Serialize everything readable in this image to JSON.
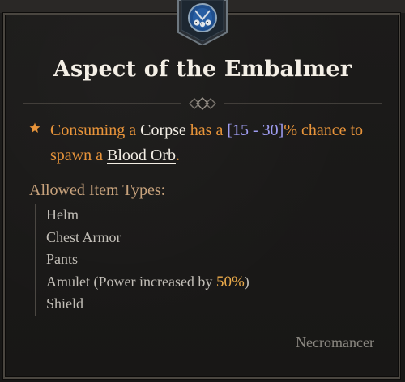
{
  "tooltip": {
    "title": "Aspect of the Embalmer",
    "affix": {
      "part1": "Consuming a ",
      "corpse": "Corpse",
      "part2": " has a ",
      "range": "[15 - 30]",
      "part3": "% chance to spawn a ",
      "blood_orb": "Blood Orb",
      "part4": "."
    },
    "allowed_header": "Allowed Item Types:",
    "item_types": [
      "Helm",
      "Chest Armor",
      "Pants",
      "Amulet (Power increased by ",
      "Shield"
    ],
    "amulet_bonus": "50%",
    "amulet_close": ")",
    "class_name": "Necromancer"
  },
  "icons": {
    "emblem": "necromancer-skull-emblem-icon",
    "bullet": "star-icon",
    "divider": "ornate-divider-icon"
  },
  "colors": {
    "affix_orange": "#e8943a",
    "value_blue": "#9e9cf0",
    "header_tan": "#c7a27c",
    "highlight_gold": "#e9a94a"
  }
}
